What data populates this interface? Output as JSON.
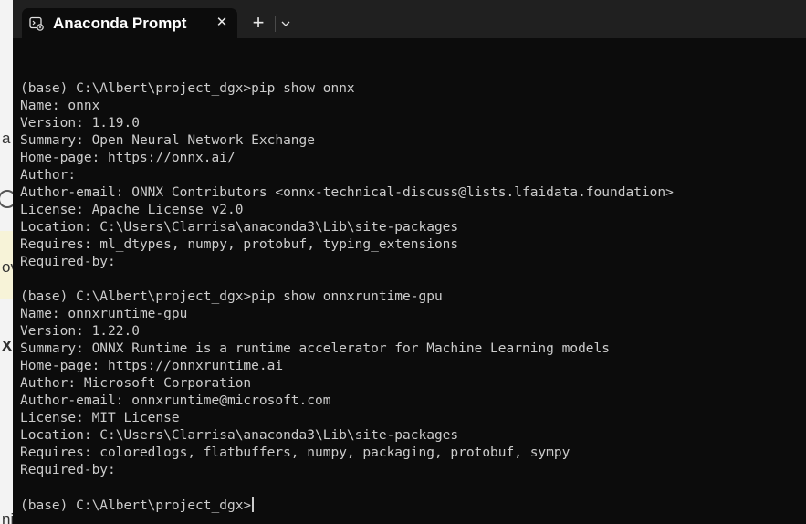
{
  "tab": {
    "title": "Anaconda Prompt",
    "close_label": "✕",
    "new_tab_label": "+"
  },
  "background_fragments": {
    "a": "a",
    "ov": "ov",
    "x": "x",
    "mi": "ni"
  },
  "terminal": {
    "lines": [
      "",
      "(base) C:\\Albert\\project_dgx>pip show onnx",
      "Name: onnx",
      "Version: 1.19.0",
      "Summary: Open Neural Network Exchange",
      "Home-page: https://onnx.ai/",
      "Author:",
      "Author-email: ONNX Contributors <onnx-technical-discuss@lists.lfaidata.foundation>",
      "License: Apache License v2.0",
      "Location: C:\\Users\\Clarrisa\\anaconda3\\Lib\\site-packages",
      "Requires: ml_dtypes, numpy, protobuf, typing_extensions",
      "Required-by:",
      "",
      "(base) C:\\Albert\\project_dgx>pip show onnxruntime-gpu",
      "Name: onnxruntime-gpu",
      "Version: 1.22.0",
      "Summary: ONNX Runtime is a runtime accelerator for Machine Learning models",
      "Home-page: https://onnxruntime.ai",
      "Author: Microsoft Corporation",
      "Author-email: onnxruntime@microsoft.com",
      "License: MIT License",
      "Location: C:\\Users\\Clarrisa\\anaconda3\\Lib\\site-packages",
      "Requires: coloredlogs, flatbuffers, numpy, packaging, protobuf, sympy",
      "Required-by:",
      "",
      "(base) C:\\Albert\\project_dgx>"
    ]
  },
  "colors": {
    "terminal_bg": "#0c0c0c",
    "titlebar_bg": "#202020",
    "text": "#cccccc"
  },
  "icons": {
    "tab_icon": "terminal-app-icon",
    "dropdown": "chevron-down-icon"
  }
}
